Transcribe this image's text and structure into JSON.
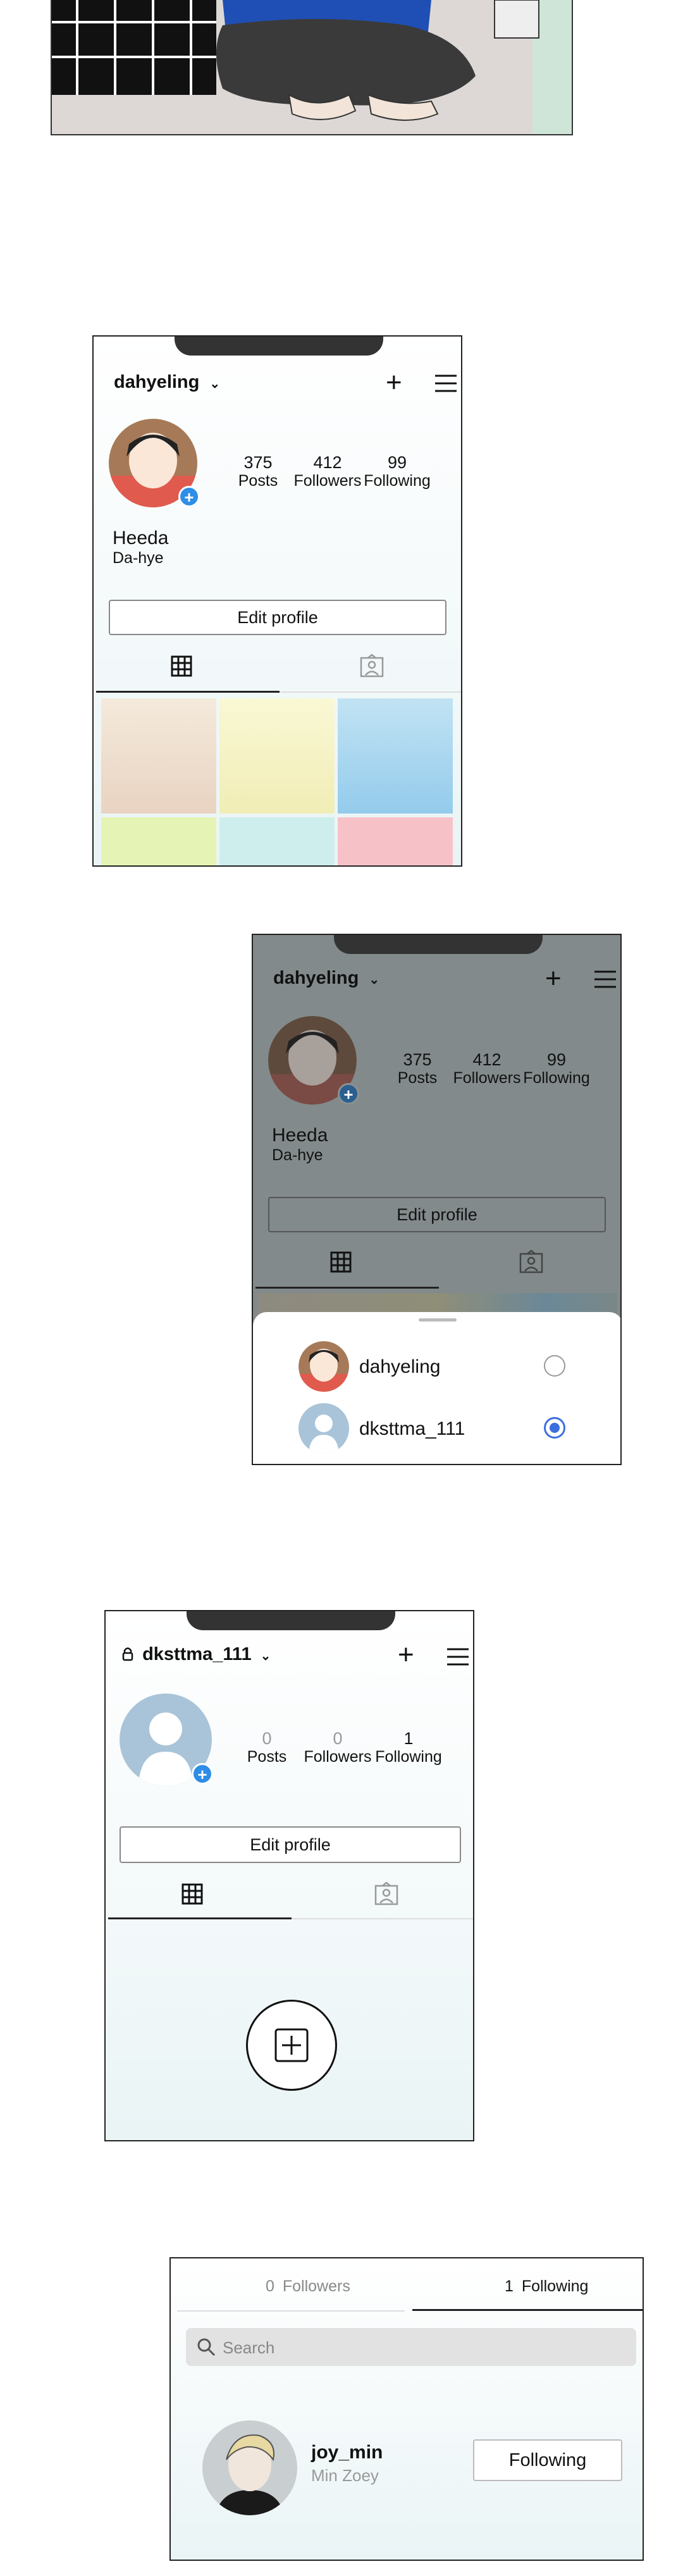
{
  "panel2": {
    "username": "dahyeling",
    "stats": [
      {
        "num": "375",
        "label": "Posts"
      },
      {
        "num": "412",
        "label": "Followers"
      },
      {
        "num": "99",
        "label": "Following"
      }
    ],
    "display_name": "Heeda",
    "sub_name": "Da-hye",
    "edit_label": "Edit profile",
    "tile_colors": [
      "#eedfcc",
      "#f5f3c6",
      "#a9d6ef",
      "#e6f2b8",
      "#cfeeee",
      "#f5c7cc"
    ]
  },
  "panel3": {
    "username": "dahyeling",
    "stats": [
      {
        "num": "375",
        "label": "Posts"
      },
      {
        "num": "412",
        "label": "Followers"
      },
      {
        "num": "99",
        "label": "Following"
      }
    ],
    "display_name": "Heeda",
    "sub_name": "Da-hye",
    "edit_label": "Edit profile",
    "accounts": [
      {
        "name": "dahyeling",
        "selected": false
      },
      {
        "name": "dksttma_111",
        "selected": true
      }
    ]
  },
  "panel4": {
    "username": "dksttma_111",
    "stats": [
      {
        "num": "0",
        "label": "Posts"
      },
      {
        "num": "0",
        "label": "Followers"
      },
      {
        "num": "1",
        "label": "Following"
      }
    ],
    "edit_label": "Edit profile"
  },
  "panel5": {
    "followers_count": "0",
    "followers_label": "Followers",
    "following_count": "1",
    "following_label": "Following",
    "search_placeholder": "Search",
    "user": {
      "handle": "joy_min",
      "name": "Min Zoey",
      "button": "Following"
    }
  },
  "colors": {
    "accent": "#2e8de6",
    "radio": "#3b6fe0"
  }
}
